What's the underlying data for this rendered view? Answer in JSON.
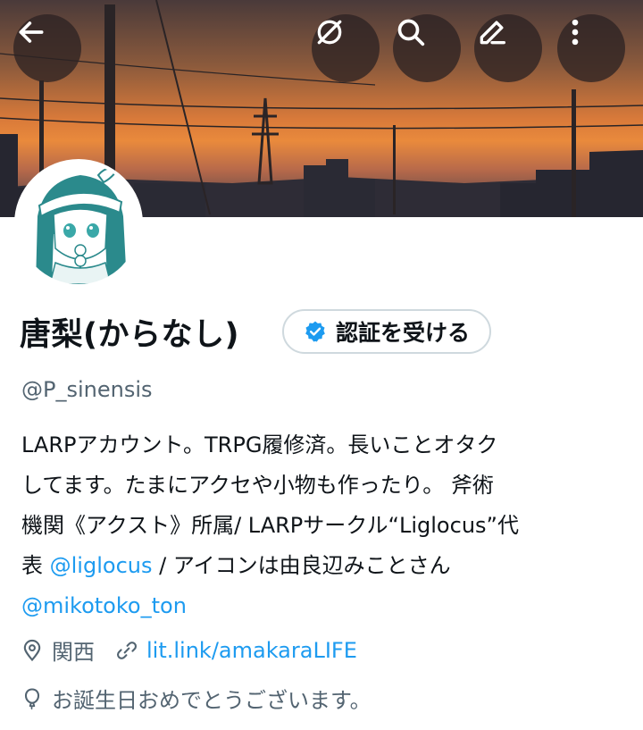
{
  "header": {
    "back_icon": "arrow-left-icon",
    "actions": [
      "mute-icon",
      "search-icon",
      "edit-icon",
      "more-icon"
    ]
  },
  "profile": {
    "display_name": "唐梨(からなし)",
    "verify_label": "認証を受ける",
    "handle": "@P_sinensis",
    "bio_lines": [
      "LARPアカウント。TRPG履修済。長いことオタク",
      "してます。たまにアクセや小物も作ったり。 斧術",
      "機関《アクスト》所属/ LARPサークル“Liglocus”代"
    ],
    "bio_line4_prefix": "表 ",
    "bio_mention1": "@liglocus",
    "bio_line4_suffix": " / アイコンは由良辺みことさん",
    "bio_mention2": "@mikotoko_ton",
    "location": "関西",
    "website": "lit.link/amakaraLIFE",
    "birthday": "お誕生日おめでとうございます。"
  },
  "colors": {
    "accent": "#1d9bf0",
    "secondary_text": "#536471",
    "primary_text": "#0f1419"
  }
}
